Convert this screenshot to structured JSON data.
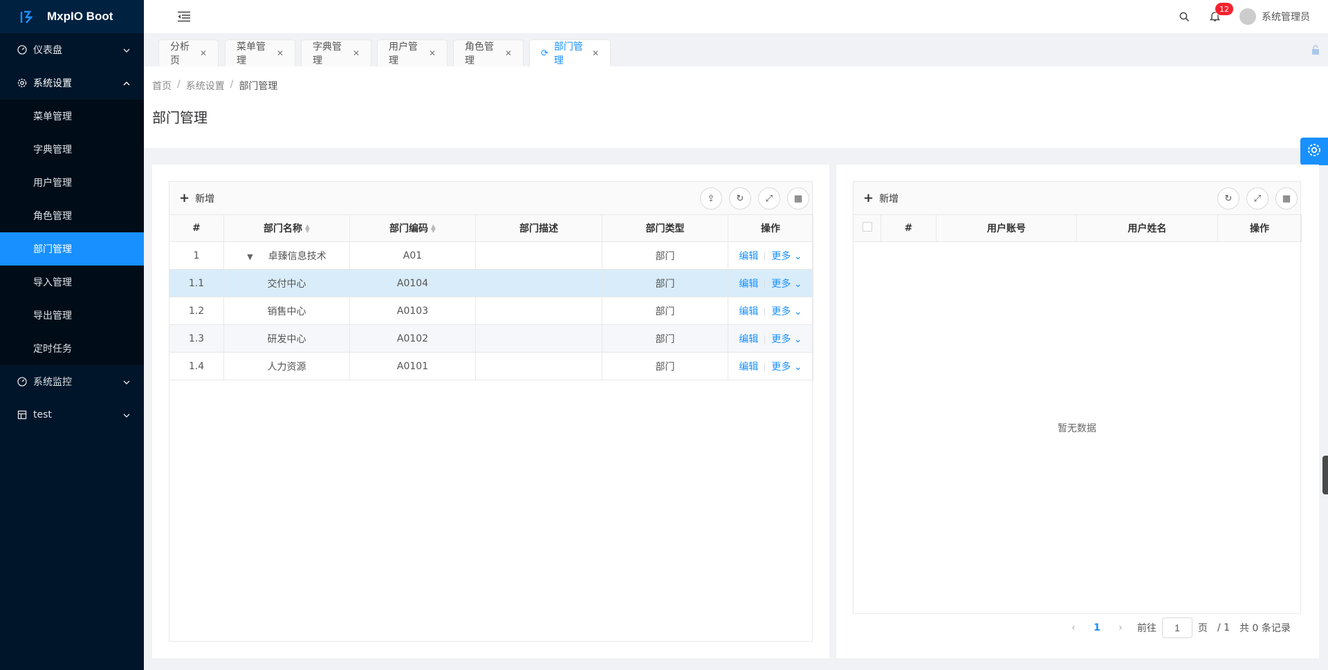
{
  "app": {
    "name": "MxpIO Boot"
  },
  "sidebar": {
    "groups": [
      {
        "label": "仪表盘",
        "icon": "dashboard-icon"
      },
      {
        "label": "系统设置",
        "icon": "gear-icon"
      },
      {
        "label": "系统监控",
        "icon": "dashboard-icon"
      },
      {
        "label": "test",
        "icon": "table-icon"
      }
    ],
    "sub_items": [
      "菜单管理",
      "字典管理",
      "用户管理",
      "角色管理",
      "部门管理",
      "导入管理",
      "导出管理",
      "定时任务"
    ]
  },
  "header": {
    "notification_count": "12",
    "username": "系统管理员"
  },
  "tabs": [
    "分析页",
    "菜单管理",
    "字典管理",
    "用户管理",
    "角色管理",
    "部门管理"
  ],
  "breadcrumb": [
    "首页",
    "系统设置",
    "部门管理"
  ],
  "page_title": "部门管理",
  "dept_table": {
    "add_label": "新增",
    "columns": [
      "#",
      "部门名称",
      "部门编码",
      "部门描述",
      "部门类型",
      "操作"
    ],
    "edit_label": "编辑",
    "more_label": "更多",
    "rows": [
      {
        "idx": "1",
        "name": "卓臻信息技术",
        "code": "A01",
        "desc": "",
        "type": "部门"
      },
      {
        "idx": "1.1",
        "name": "交付中心",
        "code": "A0104",
        "desc": "",
        "type": "部门"
      },
      {
        "idx": "1.2",
        "name": "销售中心",
        "code": "A0103",
        "desc": "",
        "type": "部门"
      },
      {
        "idx": "1.3",
        "name": "研发中心",
        "code": "A0102",
        "desc": "",
        "type": "部门"
      },
      {
        "idx": "1.4",
        "name": "人力资源",
        "code": "A0101",
        "desc": "",
        "type": "部门"
      }
    ]
  },
  "user_table": {
    "add_label": "新增",
    "columns": [
      "#",
      "用户账号",
      "用户姓名",
      "操作"
    ],
    "empty_text": "暂无数据"
  },
  "pagination": {
    "current": "1",
    "goto_label": "前往",
    "page_input": "1",
    "page_unit": "页",
    "total_pages": "/ 1",
    "total_records": "共 0 条记录"
  }
}
